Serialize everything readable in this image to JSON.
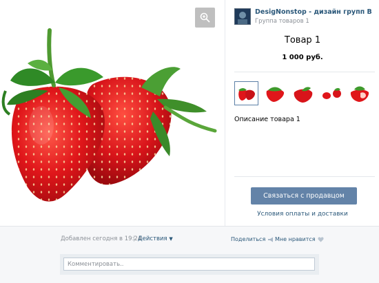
{
  "owner": {
    "name": "DesigNonstop - дизайн групп ВК, меню, ...",
    "subtitle": "Группа товаров 1"
  },
  "product": {
    "title": "Товар 1",
    "price": "1 000 руб.",
    "description": "Описание товара 1"
  },
  "thumbnails": [
    {
      "label": "thumbnail-1",
      "selected": true
    },
    {
      "label": "thumbnail-2",
      "selected": false
    },
    {
      "label": "thumbnail-3",
      "selected": false
    },
    {
      "label": "thumbnail-4",
      "selected": false
    },
    {
      "label": "thumbnail-5",
      "selected": false
    }
  ],
  "buttons": {
    "contact": "Связаться с продавцом",
    "terms": "Условия оплаты и доставки"
  },
  "footer": {
    "added": "Добавлен сегодня в 19:24",
    "separator": "|",
    "actions": "Действия",
    "share": "Поделиться",
    "like": "Мне нравится"
  },
  "comment": {
    "placeholder": "Комментировать.."
  },
  "icons": {
    "zoom": "magnifier-plus-icon",
    "actions_caret": "caret-down-icon",
    "share": "megaphone-icon",
    "like": "heart-icon"
  },
  "colors": {
    "accent": "#6383a8",
    "link": "#2b587a",
    "muted": "#8a8f96",
    "strawberry": "#e0161a",
    "leaf": "#3f9a2c"
  }
}
